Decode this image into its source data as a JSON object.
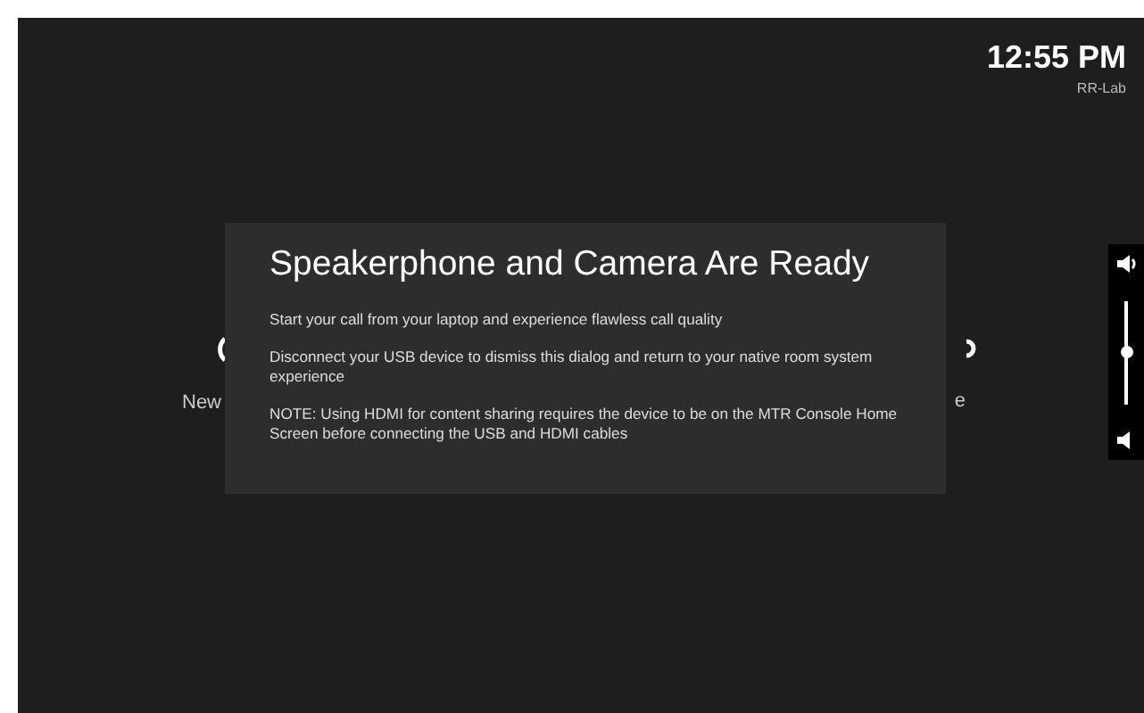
{
  "clock": {
    "time": "12:55 PM",
    "room": "RR-Lab"
  },
  "background_items": [
    {
      "label": "New"
    },
    {
      "label": "e"
    }
  ],
  "dialog": {
    "title": "Speakerphone and Camera Are Ready",
    "paragraphs": [
      "Start your call from your laptop and experience flawless call quality",
      "Disconnect your USB device to dismiss this dialog and return to your native room system experience",
      "NOTE: Using HDMI for content sharing requires the device to be on the MTR Console Home Screen before connecting the USB and HDMI cables"
    ]
  },
  "volume": {
    "level": 0.5
  }
}
